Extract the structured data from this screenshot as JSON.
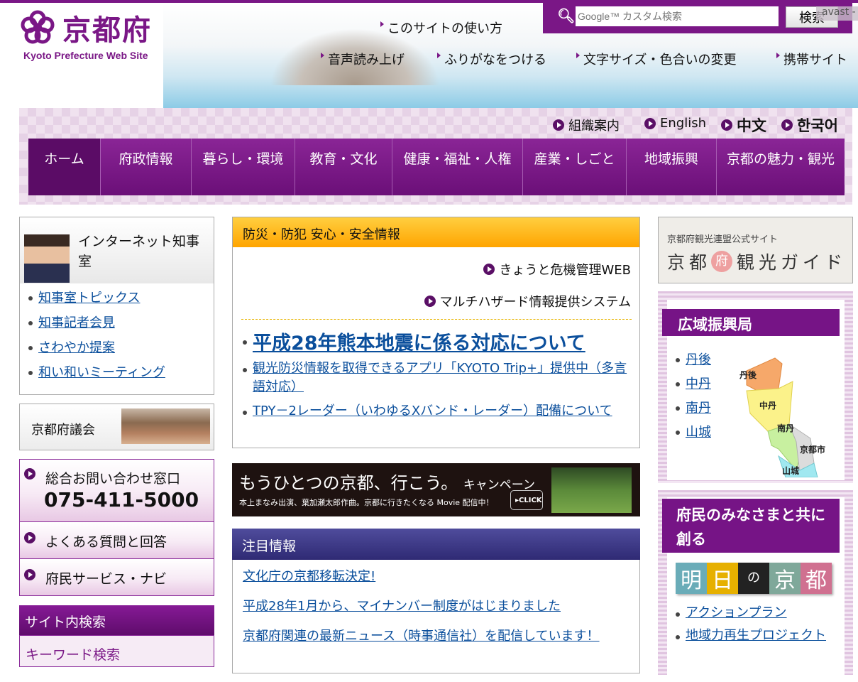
{
  "header": {
    "logo": "京都府",
    "logo_sub": "Kyoto Prefecture Web Site",
    "search_placeholder": "Google™ カスタム検索",
    "search_button": "検索",
    "avast": "avast -",
    "util_top": "このサイトの使い方",
    "util_links": [
      "音声読み上げ",
      "ふりがなをつける",
      "文字サイズ・色合いの変更",
      "携帯サイト"
    ]
  },
  "lang": [
    "組織案内",
    "English",
    "中文",
    "한국어"
  ],
  "menu": [
    "ホーム",
    "府政情報",
    "暮らし・環境",
    "教育・文化",
    "健康・福祉・人権",
    "産業・しごと",
    "地域振興",
    "京都の魅力・観光"
  ],
  "left": {
    "governor_title": "インターネット知事室",
    "governor_links": [
      "知事室トピックス",
      "知事記者会見",
      "さわやか提案",
      "和い和いミーティング"
    ],
    "assembly": "京都府議会",
    "contact_title": "総合お問い合わせ窓口",
    "contact_phone": "075-411-5000",
    "faq": "よくある質問と回答",
    "navi": "府民サービス・ナビ",
    "search_title": "サイト内検索",
    "keyword": "キーワード検索"
  },
  "center": {
    "disaster_title": "防災・防犯 安心・安全情報",
    "crisis_link": "きょうと危機管理WEB",
    "hazard_link": "マルチハザード情報提供システム",
    "news": [
      "平成28年熊本地震に係る対応について",
      "観光防災情報を取得できるアプリ「KYOTO Trip+」提供中（多言語対応）",
      "TPY－2レーダー（いわゆるXバンド・レーダー）配備について"
    ],
    "banner_title": "もうひとつの京都、行こう。",
    "banner_campaign": "キャンペーン",
    "banner_sub": "本上まなみ出演、葉加瀬太郎作曲。京都に行きたくなる Movie 配信中！",
    "banner_click": "CLICK",
    "featured_title": "注目情報",
    "featured": [
      "文化庁の京都移転決定!",
      "平成28年1月から、マイナンバー制度がはじまりました",
      "京都府関連の最新ニュース（時事通信社）を配信しています！"
    ]
  },
  "right": {
    "tour_sub": "京都府観光連盟公式サイト",
    "tour_title_a": "京都",
    "tour_fu": "府",
    "tour_title_b": "観光ガイド",
    "region_title": "広域振興局",
    "regions": [
      "丹後",
      "中丹",
      "南丹",
      "山城"
    ],
    "map_labels": [
      "丹後",
      "中丹",
      "南丹",
      "京都市",
      "山城"
    ],
    "together_title": "府民のみなさまと共に創る",
    "ashita": [
      "明",
      "日",
      "の",
      "京",
      "都"
    ],
    "together_links": [
      "アクションプラン",
      "地域力再生プロジェクト"
    ]
  }
}
